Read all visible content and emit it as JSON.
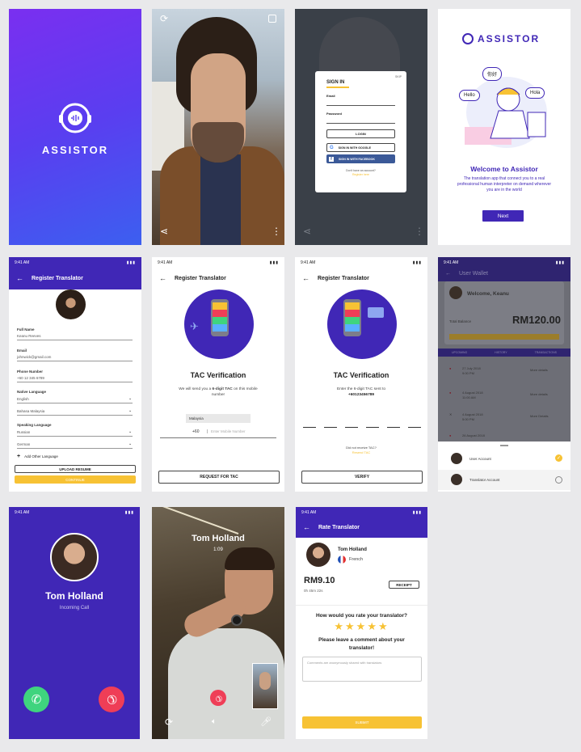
{
  "splash": {
    "brand": "ASSISTOR"
  },
  "signin": {
    "skip": "SKIP",
    "title": "SIGN IN",
    "email_label": "Email",
    "password_label": "Password",
    "login": "LOGIN",
    "google": "SIGN IN WITH GOOGLE",
    "facebook": "SIGN IN WITH FACEBOOK",
    "no_account": "Don't have an account?",
    "register": "Register here"
  },
  "welcome": {
    "brand": "ASSISTOR",
    "bubbles": [
      "你好",
      "Hello",
      "Hola"
    ],
    "title": "Welcome to Assistor",
    "desc": "The translation app that connect you to a real professional human interpreter on demand wherever you are in the world",
    "next": "Next"
  },
  "status_time": "9:41 AM",
  "register": {
    "title": "Register Translator",
    "fields": [
      {
        "label": "Full Name",
        "value": "Keanu Reeves"
      },
      {
        "label": "Email",
        "value": "johnwick@gmail.com"
      },
      {
        "label": "Phone Number",
        "value": "+60 12 345 6789"
      }
    ],
    "native_label": "Native Language",
    "native": [
      "English",
      "Bahasa Malaysia"
    ],
    "speaking_label": "Speaking Language",
    "speaking": [
      "Russian",
      "German"
    ],
    "add_language": "Add Other Language",
    "upload": "UPLOAD RESUME",
    "continue": "CONTINUE"
  },
  "tac1": {
    "title": "Register Translator",
    "heading": "TAC Verification",
    "desc_pre": "We will send you a ",
    "desc_bold": "6-digit TAC",
    "desc_post": " on this mobile number",
    "country": "Malaysia",
    "code": "+60",
    "placeholder": "Enter Mobile Number",
    "button": "REQUEST FOR TAC"
  },
  "tac2": {
    "title": "Register Translator",
    "heading": "TAC Verification",
    "desc": "Enter the 6-digit TAC sent to",
    "number": "+60123456789",
    "not_receive": "Did not receive TAC?",
    "resend": "Resend TAC",
    "button": "VERIFY"
  },
  "wallet": {
    "title": "User Wallet",
    "welcome": "Welcome, Keanu",
    "balance_label": "Total Balance",
    "balance": "RM120.00",
    "tabs": [
      "UPCOMING",
      "HISTORY",
      "TRANSACTIONS"
    ],
    "rows": [
      {
        "date": "27 July 2018",
        "time": "9:00 PM",
        "link": "More details"
      },
      {
        "date": "4 August 2018",
        "time": "11:00 AM",
        "link": "More details"
      },
      {
        "date": "4 August 2018",
        "time": "5:00 PM",
        "link": "More Details"
      },
      {
        "date": "26 August 2018",
        "time": "",
        "link": ""
      }
    ],
    "accounts": [
      {
        "label": "User Account",
        "selected": true
      },
      {
        "label": "Translator Account",
        "selected": false
      }
    ]
  },
  "incoming": {
    "name": "Tom Holland",
    "status": "Incoming Call"
  },
  "video": {
    "name": "Tom Holland",
    "time": "1:09"
  },
  "rate": {
    "title": "Rate Translator",
    "name": "Tom Holland",
    "language": "French",
    "amount": "RM9.10",
    "duration": "0h 45m 22s",
    "receipt": "RECEIPT",
    "question": "How would you rate your translator?",
    "stars": 5,
    "comment_title": "Please leave a comment about your translator!",
    "placeholder": "Comments are anonymously shared with translators",
    "submit": "SUBMIT"
  },
  "colors": {
    "primary": "#4027b6",
    "accent": "#f7c234",
    "green": "#3fd47e",
    "red": "#ef3e57"
  }
}
